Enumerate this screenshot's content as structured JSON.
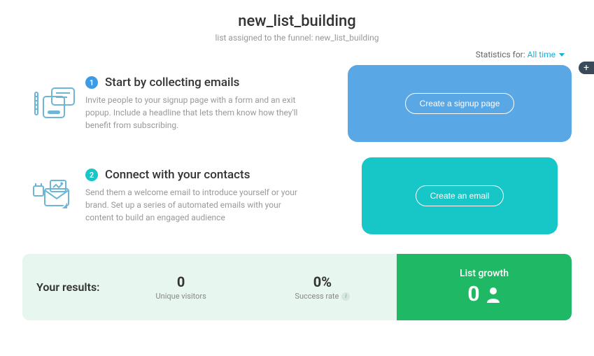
{
  "header": {
    "title": "new_list_building",
    "subtitle": "list assigned to the funnel: new_list_building"
  },
  "stats": {
    "label": "Statistics for:",
    "range": "All time"
  },
  "steps": [
    {
      "num": "1",
      "title": "Start by collecting emails",
      "desc": "Invite people to your signup page with a form and an exit popup. Include a headline that lets them know how they'll benefit from subscribing.",
      "button": "Create a signup page"
    },
    {
      "num": "2",
      "title": "Connect with your contacts",
      "desc": "Send them a welcome email to introduce yourself or your brand. Set up a series of automated emails with your content to build an engaged audience",
      "button": "Create an email"
    }
  ],
  "results": {
    "label": "Your results:",
    "unique_visitors": {
      "value": "0",
      "caption": "Unique visitors"
    },
    "success_rate": {
      "value": "0%",
      "caption": "Success rate"
    },
    "growth": {
      "label": "List growth",
      "value": "0"
    }
  }
}
